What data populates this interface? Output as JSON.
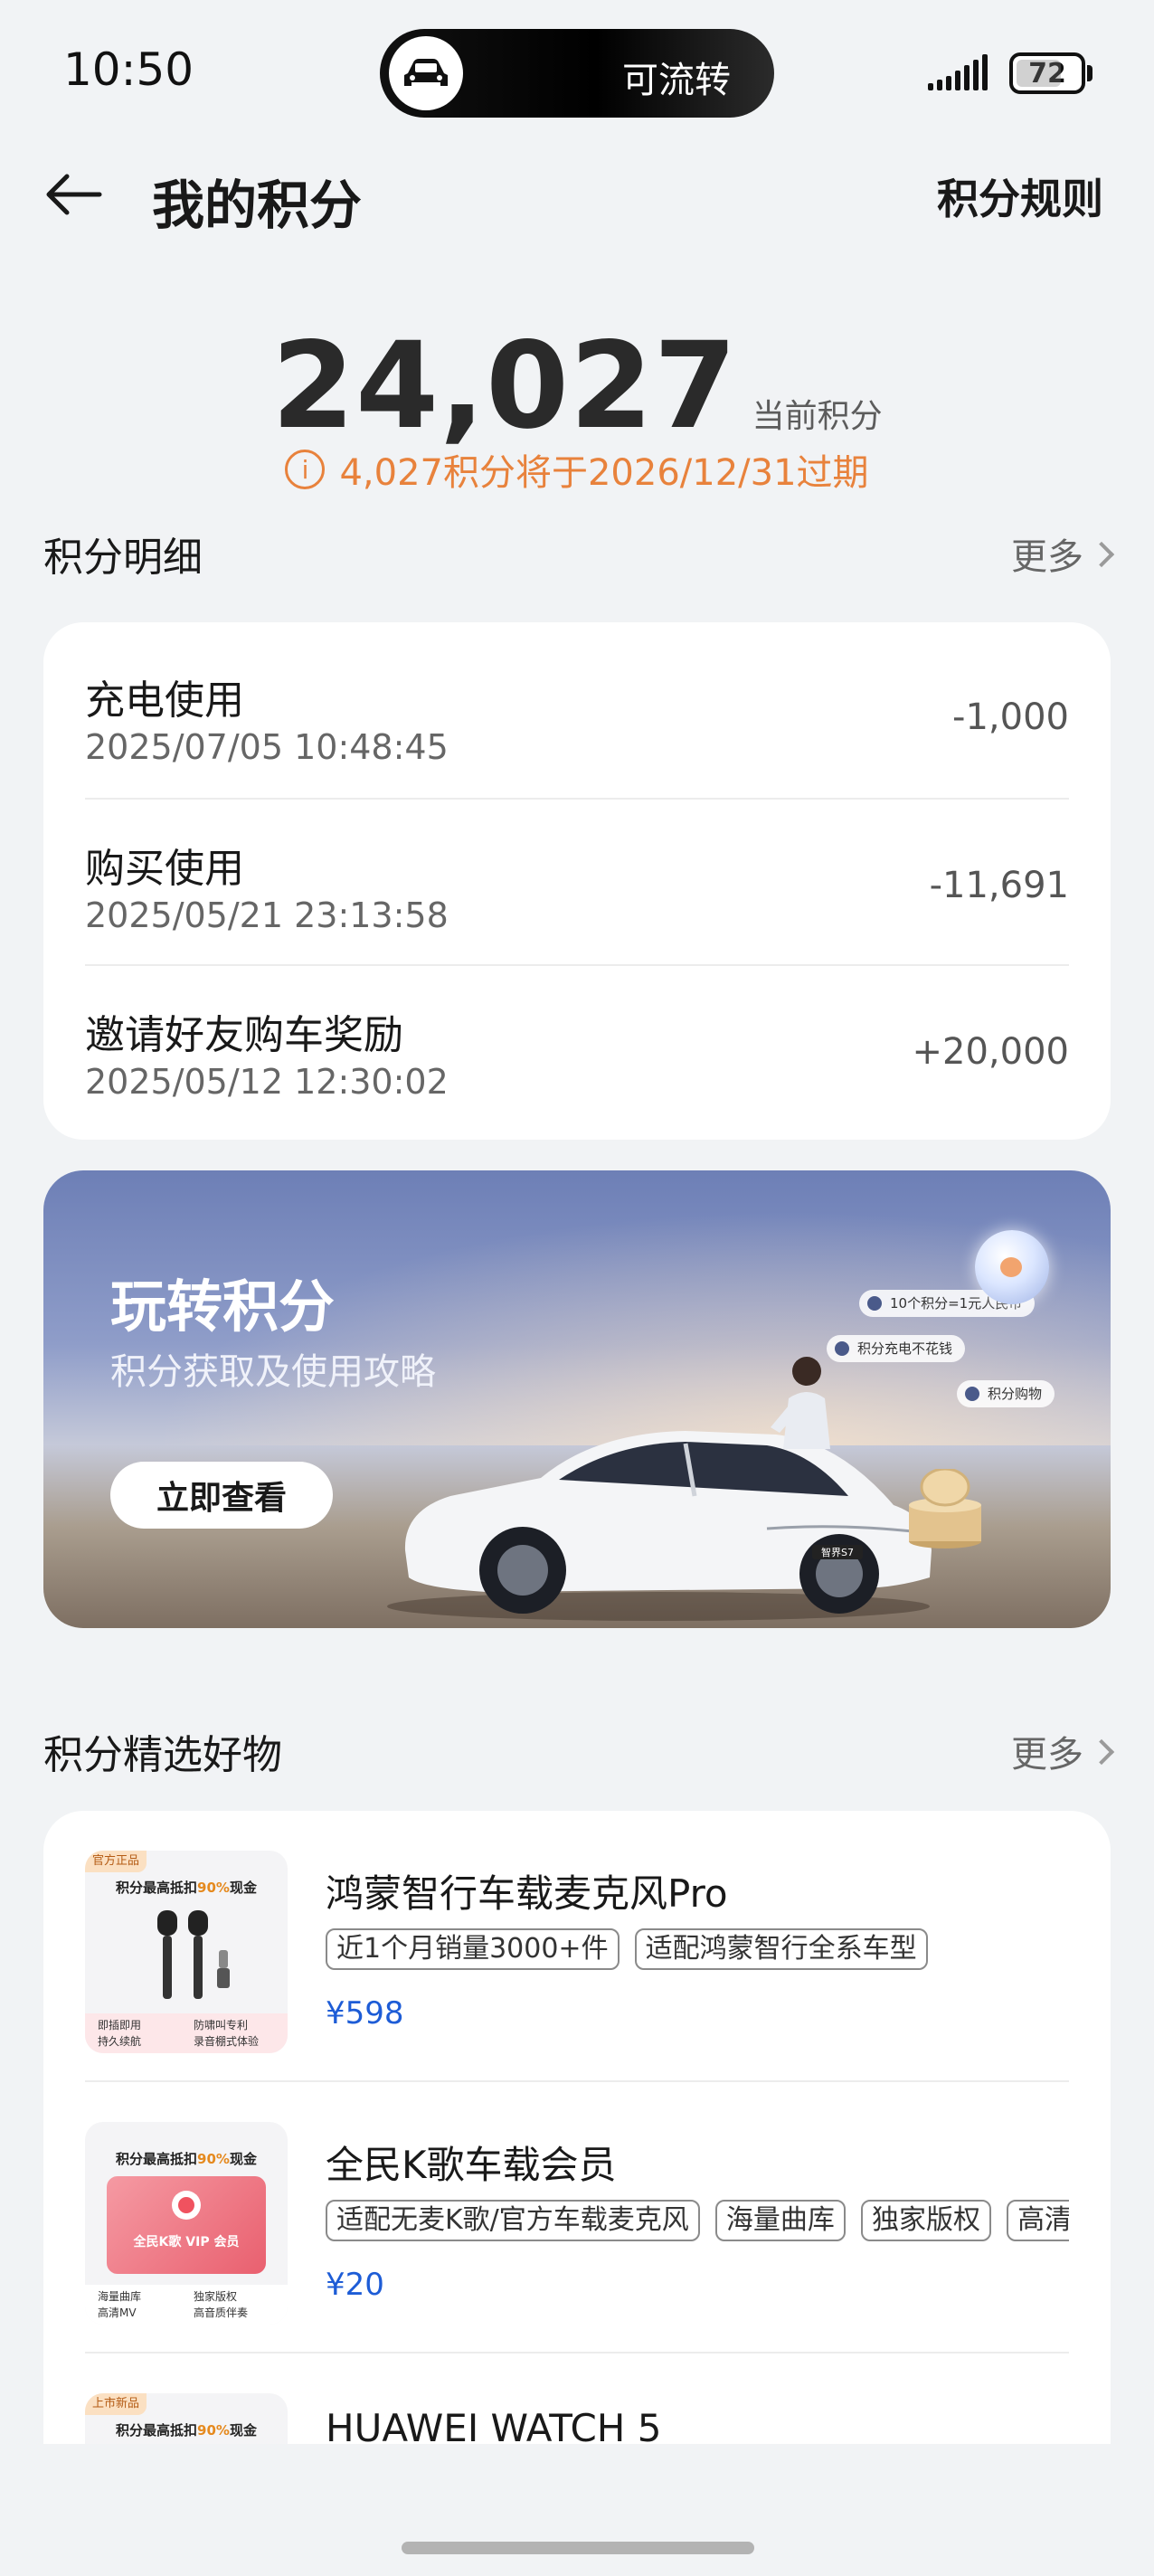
{
  "status_bar": {
    "time": "10:50",
    "island_label": "可流转",
    "battery": "72",
    "battery_level_percent": 72
  },
  "header": {
    "title": "我的积分",
    "rules_label": "积分规则"
  },
  "summary": {
    "points": "24,027",
    "points_label": "当前积分",
    "expire_notice": "4,027积分将于2026/12/31过期",
    "accent_color": "#e8823c"
  },
  "details": {
    "title": "积分明细",
    "more_label": "更多",
    "rows": [
      {
        "name": "充电使用",
        "time": "2025/07/05 10:48:45",
        "amount": "-1,000"
      },
      {
        "name": "购买使用",
        "time": "2025/05/21 23:13:58",
        "amount": "-11,691"
      },
      {
        "name": "邀请好友购车奖励",
        "time": "2025/05/12 12:30:02",
        "amount": "+20,000"
      }
    ]
  },
  "banner": {
    "title": "玩转积分",
    "subtitle": "积分获取及使用攻略",
    "button_label": "立即查看",
    "tags": [
      "10个积分=1元人民币",
      "积分充电不花钱",
      "积分购物"
    ],
    "car_plate": "智界S7"
  },
  "goods": {
    "title": "积分精选好物",
    "more_label": "更多",
    "price_color": "#1d5cd6",
    "items": [
      {
        "name": "鸿蒙智行车载麦克风Pro",
        "tags": [
          "近1个月销量3000+件",
          "适配鸿蒙智行全系车型"
        ],
        "price": "¥598",
        "thumb_badge": "官方正品",
        "thumb_head_prefix": "积分最高抵扣",
        "thumb_head_highlight": "90%",
        "thumb_head_suffix": "现金",
        "thumb_foot": [
          "即插即用",
          "防啸叫专利",
          "持久续航",
          "录音棚式体验"
        ]
      },
      {
        "name": "全民K歌车载会员",
        "tags": [
          "适配无麦K歌/官方车载麦克风",
          "海量曲库",
          "独家版权",
          "高清MV"
        ],
        "price": "¥20",
        "thumb_head_prefix": "积分最高抵扣",
        "thumb_head_highlight": "90%",
        "thumb_head_suffix": "现金",
        "thumb_card_label": "全民K歌 VIP 会员",
        "thumb_foot": [
          "海量曲库",
          "独家版权",
          "高清MV",
          "高音质伴奏"
        ]
      },
      {
        "name": "HUAWEI WATCH 5",
        "thumb_badge": "上市新品",
        "thumb_head_prefix": "积分最高抵扣",
        "thumb_head_highlight": "90%",
        "thumb_head_suffix": "现金"
      }
    ]
  }
}
